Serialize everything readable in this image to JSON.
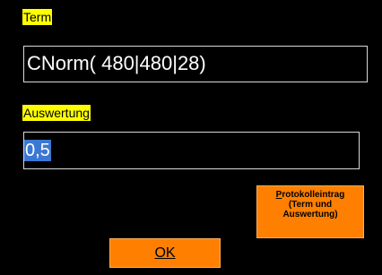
{
  "term": {
    "label": "Term",
    "value": "CNorm( 480|480|28)"
  },
  "auswertung": {
    "label": "Auswertung",
    "value": "0,5"
  },
  "buttons": {
    "protokoll": {
      "first_char": "P",
      "rest_line1": "rotokolleintrag",
      "line2": "(Term und",
      "line3": "Auswertung)"
    },
    "ok": {
      "label": "OK"
    }
  },
  "colors": {
    "background": "#000000",
    "label_highlight": "#ffff00",
    "button": "#ff7f00",
    "selection": "#3b78d4"
  }
}
